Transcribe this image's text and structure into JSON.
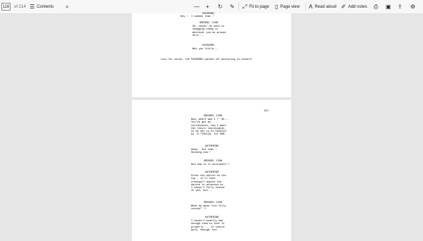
{
  "toolbar": {
    "page_number": "116",
    "page_total": "of 214",
    "contents_label": "Contents",
    "fit_label": "Fit to page",
    "page_view_label": "Page view",
    "read_aloud_label": "Read aloud",
    "add_notes_label": "Add notes"
  },
  "page1": {
    "b1_name": "PASSERBY",
    "b1_line": "Hey !  I seeeen that !",
    "b2_name": "GRENDEL JINN",
    "b2_lines": "Uh, shush! Go back to\nshagging sheep or\nwherever you do around\nhere...",
    "b3_name": "PASSERBY",
    "b3_line": "Why you little...",
    "action": "Lost for words, the PASSERBY walked off muttering to himself"
  },
  "page2": {
    "page_label": "122.",
    "b1_name": "GRENDEL JINN",
    "b1_lines": "Now, where was I ?  Ah...\nYou've got my\ncoordinates, now I want\nthe return coordinates\nto be set to 51.5252219\nby -0.7705142, for 6AM",
    "b2_name": "KATHERINE",
    "b2_lines": "Okay!  Got that !\nSending now !",
    "b3_name": "GRENDEL JINN",
    "b3_line": "And how is it activated ?",
    "b4_name": "KATHERINE",
    "b4_lines": "Press the button on the\ntop - it'll then\ntransport anyone the\ndevice is attached to.\nI haven't fully tested\nit yet, but...",
    "b5_name": "GRENDEL JINN",
    "b5_lines": "What do mean \"not fully\ntested\" !?",
    "b6_name": "KATHERINE",
    "b6_lines": "I haven't exactly had\nenough time to test it\nproperly...  It should\nwork, though, but..."
  }
}
